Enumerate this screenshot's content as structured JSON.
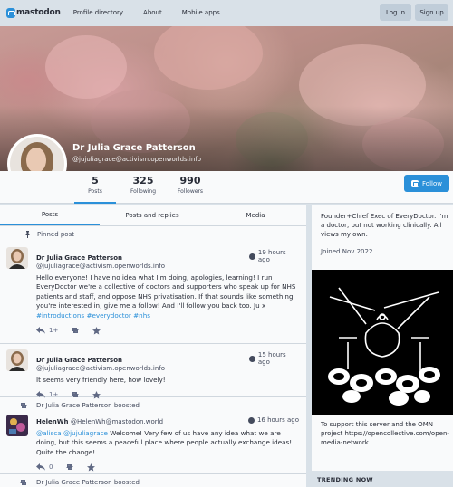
{
  "nav": {
    "logo_text": "mastodon",
    "links": [
      "Profile directory",
      "About",
      "Mobile apps"
    ],
    "login_label": "Log in",
    "signup_label": "Sign up"
  },
  "profile": {
    "display_name": "Dr Julia Grace Patterson",
    "account": "@jujuliagrace@activism.openworlds.info",
    "stats": [
      {
        "value": "5",
        "label": "Posts"
      },
      {
        "value": "325",
        "label": "Following"
      },
      {
        "value": "990",
        "label": "Followers"
      }
    ],
    "follow_label": "Follow"
  },
  "tabs": [
    "Posts",
    "Posts and replies",
    "Media"
  ],
  "timeline": {
    "pinned_label": "Pinned post",
    "statuses": [
      {
        "name": "Dr Julia Grace Patterson",
        "acct": "@jujuliagrace@activism.openworlds.info",
        "time": "19 hours ago",
        "text_plain": "Hello everyone! I have no idea what I'm doing, apologies, learning! I run EveryDoctor we're a collective of doctors and supporters who speak up for NHS patients and staff, and oppose NHS privatisation. If that sounds like something you're interested in, give me a follow! And I'll follow you back too. Ju x ",
        "text_tags": "#introductions #everydoctor #nhs",
        "reply_count": "1+"
      },
      {
        "name": "Dr Julia Grace Patterson",
        "acct": "@jujuliagrace@activism.openworlds.info",
        "time": "15 hours ago",
        "text_plain": "It seems very friendly here, how lovely!",
        "reply_count": "1+"
      },
      {
        "boosted_by": "Dr Julia Grace Patterson boosted",
        "name": "HelenWh",
        "acct": "@HelenWh@mastodon.world",
        "time": "16 hours ago",
        "mention_1": "@alisca",
        "mention_2": "@jujuliagrace",
        "text_plain": " Welcome! Very few of us have any idea what we are doing, but this seems a peaceful place where people actually exchange ideas! Quite the change!",
        "reply_count": "0"
      }
    ],
    "last_boost": "Dr Julia Grace Patterson boosted"
  },
  "sidebar": {
    "bio": "Founder+Chief Exec of EveryDoctor. I'm a doctor, but not working clinically. All views my own.",
    "joined": "Joined Nov 2022",
    "server_text": "To support this server and the OMN project https://opencollective.com/open-media-network",
    "trending": "TRENDING NOW"
  },
  "colors": {
    "accent": "#2b90d9",
    "background": "#d9e1e8",
    "panel": "#f9fafb"
  }
}
